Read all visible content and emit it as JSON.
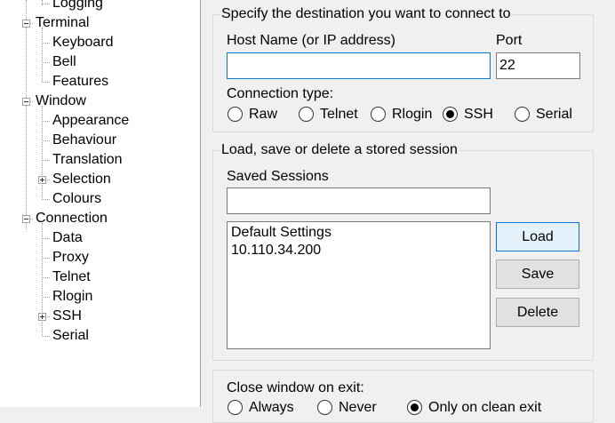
{
  "tree": {
    "items": [
      {
        "label": "Logging",
        "level": 1
      },
      {
        "label": "Terminal",
        "level": 0,
        "expander": "minus"
      },
      {
        "label": "Keyboard",
        "level": 1
      },
      {
        "label": "Bell",
        "level": 1
      },
      {
        "label": "Features",
        "level": 1
      },
      {
        "label": "Window",
        "level": 0,
        "expander": "minus"
      },
      {
        "label": "Appearance",
        "level": 1
      },
      {
        "label": "Behaviour",
        "level": 1
      },
      {
        "label": "Translation",
        "level": 1
      },
      {
        "label": "Selection",
        "level": 1,
        "expander": "plus"
      },
      {
        "label": "Colours",
        "level": 1
      },
      {
        "label": "Connection",
        "level": 0,
        "expander": "minus"
      },
      {
        "label": "Data",
        "level": 1
      },
      {
        "label": "Proxy",
        "level": 1
      },
      {
        "label": "Telnet",
        "level": 1
      },
      {
        "label": "Rlogin",
        "level": 1
      },
      {
        "label": "SSH",
        "level": 1,
        "expander": "plus"
      },
      {
        "label": "Serial",
        "level": 1
      }
    ]
  },
  "destination": {
    "title": "Specify the destination you want to connect to",
    "host_label": "Host Name (or IP address)",
    "host_value": "",
    "port_label": "Port",
    "port_value": "22",
    "conn_type_label": "Connection type:",
    "conn_types": [
      {
        "label": "Raw",
        "checked": false
      },
      {
        "label": "Telnet",
        "checked": false
      },
      {
        "label": "Rlogin",
        "checked": false
      },
      {
        "label": "SSH",
        "checked": true
      },
      {
        "label": "Serial",
        "checked": false
      }
    ]
  },
  "sessions": {
    "title": "Load, save or delete a stored session",
    "saved_label": "Saved Sessions",
    "saved_value": "",
    "list": [
      "Default Settings",
      "10.110.34.200"
    ],
    "load_label": "Load",
    "save_label": "Save",
    "delete_label": "Delete"
  },
  "exit": {
    "label": "Close window on exit:",
    "options": [
      {
        "label": "Always",
        "checked": false
      },
      {
        "label": "Never",
        "checked": false
      },
      {
        "label": "Only on clean exit",
        "checked": true
      }
    ]
  },
  "colors": {
    "focus_border": "#0078d7",
    "panel_bg": "#f0f0f0"
  }
}
